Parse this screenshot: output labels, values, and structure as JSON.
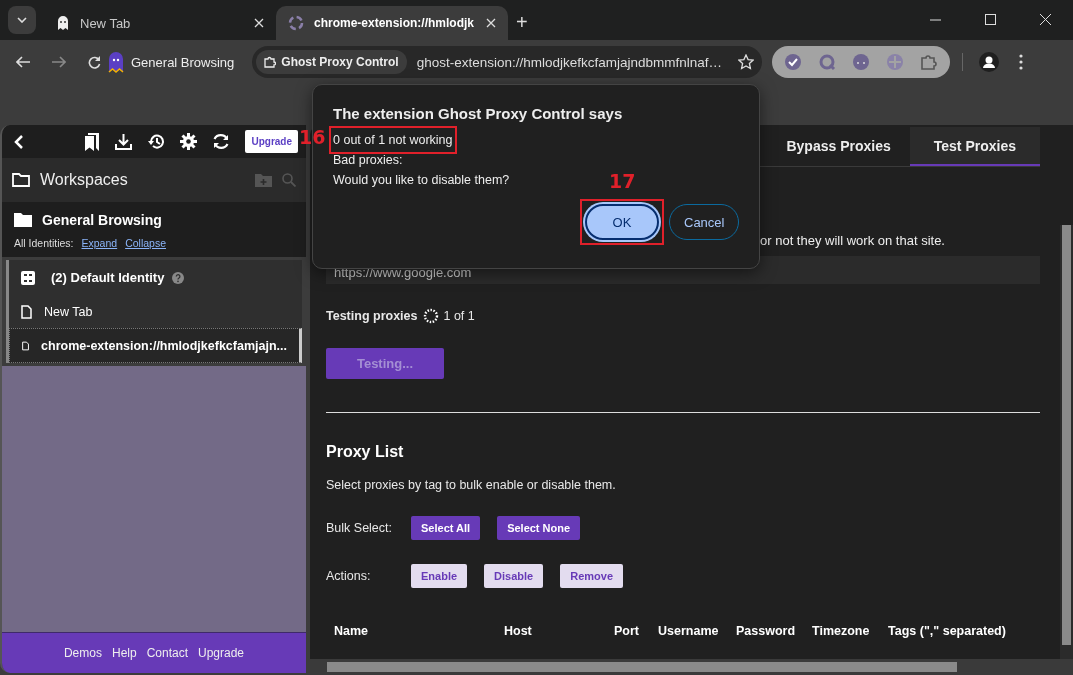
{
  "browser_tabs": [
    {
      "label": "New Tab",
      "selected": false
    },
    {
      "label": "chrome-extension://hmlodjk",
      "selected": true
    }
  ],
  "new_tab_button": "+",
  "toolbar": {
    "profile": "General Browsing",
    "site_chip": "Ghost Proxy Control",
    "url": "ghost-extension://hmlodjkefkcfamjajndbmmfnlnaf…"
  },
  "sidebar": {
    "upgrade_button": "Upgrade",
    "workspaces_title": "Workspaces",
    "workspace": "General Browsing",
    "identities_label": "All Identities:",
    "expand_link": "Expand",
    "collapse_link": "Collapse",
    "identity": "(2) Default Identity",
    "items": [
      {
        "label": "New Tab",
        "selected": false
      },
      {
        "label": "chrome-extension://hmlodjkefkcfamjajn...",
        "selected": true
      }
    ],
    "footer_links": [
      "Demos",
      "Help",
      "Contact",
      "Upgrade"
    ]
  },
  "main": {
    "tabs": [
      {
        "label": "Bypass Proxies",
        "selected": false
      },
      {
        "label": "Test Proxies",
        "selected": true
      }
    ],
    "intro_fragment": "or not they will work on that site.",
    "url_value": "https://www.google.com",
    "testing_label": "Testing proxies",
    "testing_progress": "1 of 1",
    "test_button": {
      "label": "Testing...",
      "disabled": true
    },
    "proxy_list_title": "Proxy List",
    "proxy_list_description": "Select proxies by tag to bulk enable or disable them.",
    "bulk_select_label": "Bulk Select:",
    "bulk_buttons": [
      "Select All",
      "Select None"
    ],
    "actions_label": "Actions:",
    "action_buttons": [
      "Enable",
      "Disable",
      "Remove"
    ],
    "table": {
      "columns": [
        "Name",
        "Host",
        "Port",
        "Username",
        "Password",
        "Timezone",
        "Tags (\",\" separated)"
      ]
    }
  },
  "dialog": {
    "title": "The extension Ghost Proxy Control says",
    "messages": [
      {
        "text": "0 out of 1 not working",
        "marker": "16"
      },
      {
        "text": "Bad proxies:"
      },
      {
        "text": "Would you like to disable them?"
      }
    ],
    "buttons": [
      {
        "label": "OK",
        "kind": "primary",
        "marker": "17"
      },
      {
        "label": "Cancel",
        "kind": "secondary"
      }
    ]
  }
}
